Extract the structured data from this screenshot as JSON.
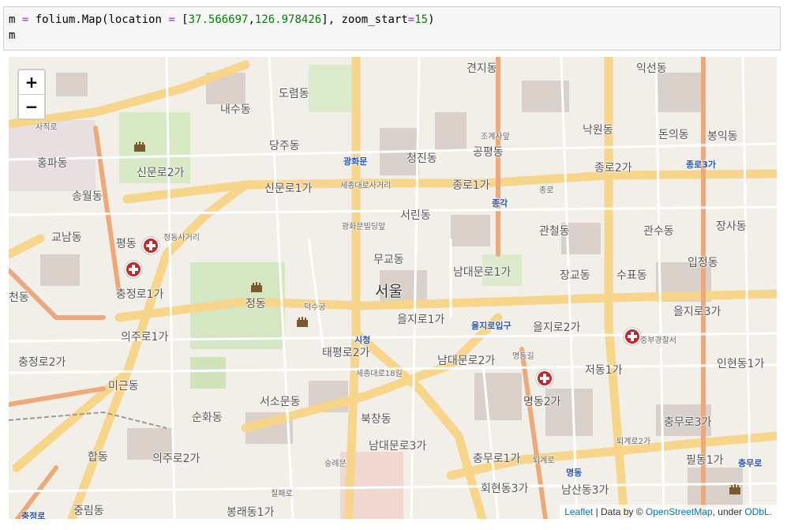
{
  "code_cell": {
    "line1_var": "m ",
    "line1_eq": "=",
    "line1_call": " folium.Map(location ",
    "line1_eq2": "=",
    "line1_open": " [",
    "line1_lat": "37.566697",
    "line1_comma": ",",
    "line1_lon": "126.978426",
    "line1_close": "], zoom_start",
    "line1_eq3": "=",
    "line1_zoom": "15",
    "line1_end": ")",
    "line2": "m"
  },
  "map": {
    "zoom_in_label": "+",
    "zoom_out_label": "−",
    "attribution": {
      "leaflet": "Leaflet",
      "sep": " | Data by © ",
      "osm": "OpenStreetMap",
      "under": ", under ",
      "odbl": "ODbL."
    },
    "labels": [
      {
        "text": "견지동",
        "cls": "med"
      },
      {
        "text": "익선동",
        "cls": "med"
      },
      {
        "text": "내수동",
        "cls": "med"
      },
      {
        "text": "도렴동",
        "cls": "med"
      },
      {
        "text": "사직로",
        "cls": "sm"
      },
      {
        "text": "당주동",
        "cls": "med"
      },
      {
        "text": "조계사앞",
        "cls": "sm"
      },
      {
        "text": "공평동",
        "cls": "med"
      },
      {
        "text": "낙원동",
        "cls": "med"
      },
      {
        "text": "돈의동",
        "cls": "med"
      },
      {
        "text": "봉익동",
        "cls": "med"
      },
      {
        "text": "홍파동",
        "cls": "med"
      },
      {
        "text": "광화문",
        "cls": "blue"
      },
      {
        "text": "청진동",
        "cls": "med"
      },
      {
        "text": "종로2가",
        "cls": "med"
      },
      {
        "text": "종로3가",
        "cls": "blue"
      },
      {
        "text": "신문로2가",
        "cls": "med"
      },
      {
        "text": "송월동",
        "cls": "med"
      },
      {
        "text": "신문로1가",
        "cls": "med"
      },
      {
        "text": "세종대로사거리",
        "cls": "sm"
      },
      {
        "text": "종로1가",
        "cls": "med"
      },
      {
        "text": "종로",
        "cls": "sm"
      },
      {
        "text": "종각",
        "cls": "blue"
      },
      {
        "text": "서린동",
        "cls": "med"
      },
      {
        "text": "관철동",
        "cls": "med"
      },
      {
        "text": "관수동",
        "cls": "med"
      },
      {
        "text": "장사동",
        "cls": "med"
      },
      {
        "text": "교남동",
        "cls": "med"
      },
      {
        "text": "평동",
        "cls": "med"
      },
      {
        "text": "정동사거리",
        "cls": "sm"
      },
      {
        "text": "광화문빌딩앞",
        "cls": "sm"
      },
      {
        "text": "무교동",
        "cls": "med"
      },
      {
        "text": "남대문로1가",
        "cls": "med"
      },
      {
        "text": "장교동",
        "cls": "med"
      },
      {
        "text": "수표동",
        "cls": "med"
      },
      {
        "text": "입정동",
        "cls": "med"
      },
      {
        "text": "서울",
        "cls": "xl"
      },
      {
        "text": "천동",
        "cls": "med"
      },
      {
        "text": "충정로1가",
        "cls": "med"
      },
      {
        "text": "정동",
        "cls": "med"
      },
      {
        "text": "덕수궁",
        "cls": "sm"
      },
      {
        "text": "을지로1가",
        "cls": "med"
      },
      {
        "text": "을지로입구",
        "cls": "blue"
      },
      {
        "text": "을지로2가",
        "cls": "med"
      },
      {
        "text": "을지로3가",
        "cls": "med"
      },
      {
        "text": "의주로1가",
        "cls": "med"
      },
      {
        "text": "시청",
        "cls": "blue"
      },
      {
        "text": "태평로2가",
        "cls": "med"
      },
      {
        "text": "중부경찰서",
        "cls": "sm"
      },
      {
        "text": "충정로2가",
        "cls": "med"
      },
      {
        "text": "남대문로2가",
        "cls": "med"
      },
      {
        "text": "명동길",
        "cls": "sm"
      },
      {
        "text": "저동1가",
        "cls": "med"
      },
      {
        "text": "인현동1가",
        "cls": "med"
      },
      {
        "text": "미근동",
        "cls": "med"
      },
      {
        "text": "세종대로18길",
        "cls": "sm"
      },
      {
        "text": "서소문동",
        "cls": "med"
      },
      {
        "text": "명동2가",
        "cls": "med"
      },
      {
        "text": "순화동",
        "cls": "med"
      },
      {
        "text": "북창동",
        "cls": "med"
      },
      {
        "text": "충무로3가",
        "cls": "med"
      },
      {
        "text": "퇴계로2가",
        "cls": "sm"
      },
      {
        "text": "합동",
        "cls": "med"
      },
      {
        "text": "의주로2가",
        "cls": "med"
      },
      {
        "text": "남대문로3가",
        "cls": "med"
      },
      {
        "text": "충무로1가",
        "cls": "med"
      },
      {
        "text": "퇴계로",
        "cls": "sm"
      },
      {
        "text": "필동1가",
        "cls": "med"
      },
      {
        "text": "숭례문",
        "cls": "sm"
      },
      {
        "text": "명동",
        "cls": "blue"
      },
      {
        "text": "충무로",
        "cls": "blue"
      },
      {
        "text": "중림동",
        "cls": "med"
      },
      {
        "text": "회현동3가",
        "cls": "med"
      },
      {
        "text": "남산동3가",
        "cls": "med"
      },
      {
        "text": "봉래동1가",
        "cls": "med"
      },
      {
        "text": "충정로",
        "cls": "blue"
      },
      {
        "text": "칠패로",
        "cls": "sm"
      }
    ]
  }
}
